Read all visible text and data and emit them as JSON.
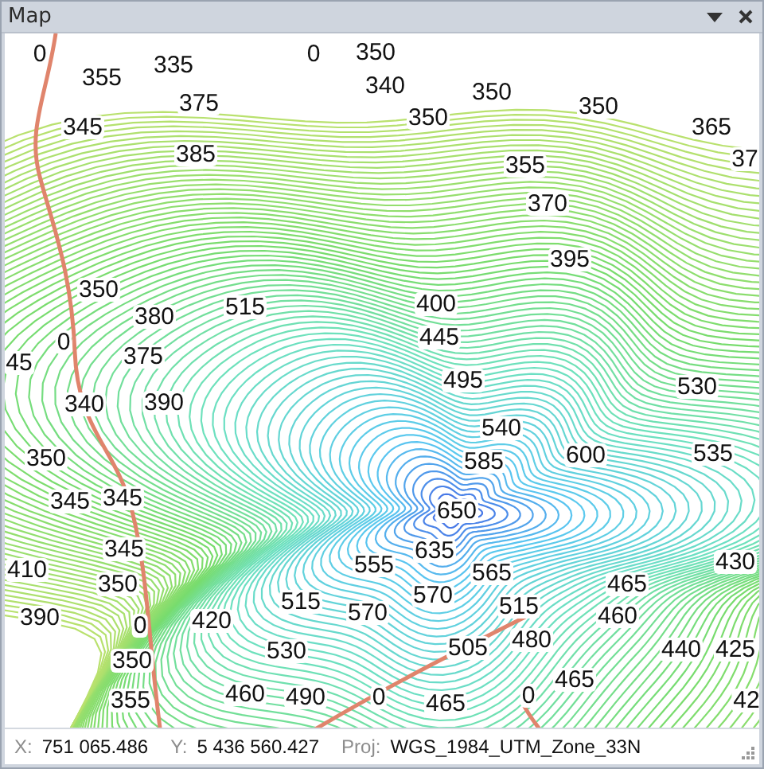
{
  "window": {
    "title": "Map"
  },
  "map": {
    "labels": [
      "0",
      "355",
      "335",
      "375",
      "345",
      "385",
      "0",
      "350",
      "340",
      "350",
      "350",
      "350",
      "365",
      "355",
      "37",
      "370",
      "395",
      "350",
      "380",
      "515",
      "400",
      "445",
      "0",
      "45",
      "375",
      "495",
      "530",
      "340",
      "390",
      "540",
      "350",
      "585",
      "600",
      "535",
      "345",
      "345",
      "650",
      "345",
      "410",
      "635",
      "555",
      "565",
      "430",
      "350",
      "465",
      "570",
      "390",
      "515",
      "515",
      "0",
      "420",
      "570",
      "460",
      "530",
      "505",
      "480",
      "440",
      "425",
      "350",
      "465",
      "355",
      "460",
      "490",
      "0",
      "465",
      "0",
      "42"
    ]
  },
  "status_bar": {
    "fields": [
      {
        "label": "X:",
        "value": "751 065.486"
      },
      {
        "label": "Y:",
        "value": "5 436 560.427"
      },
      {
        "label": "Proj:",
        "value": "WGS_1984_UTM_Zone_33N"
      }
    ]
  }
}
